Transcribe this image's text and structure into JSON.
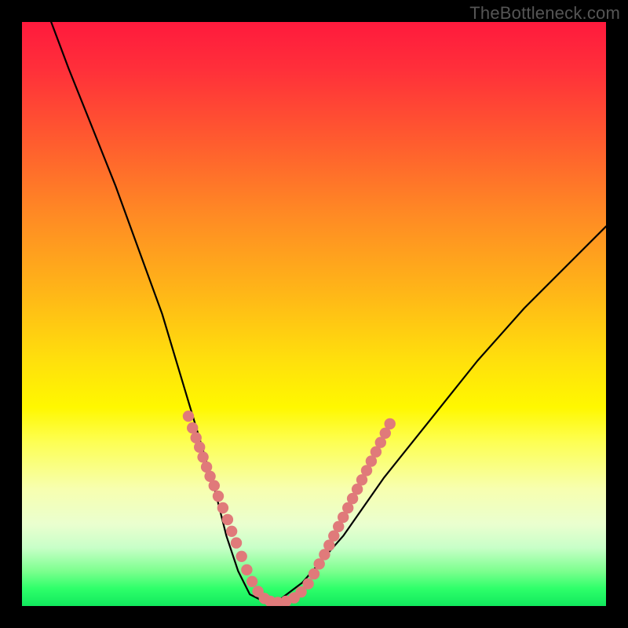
{
  "watermark": "TheBottleneck.com",
  "chart_data": {
    "type": "line",
    "title": "",
    "xlabel": "",
    "ylabel": "",
    "xlim": [
      0,
      100
    ],
    "ylim": [
      0,
      100
    ],
    "series": [
      {
        "name": "bottleneck-curve",
        "x": [
          5,
          8,
          12,
          16,
          20,
          24,
          27,
          30,
          33,
          35,
          37,
          39,
          41,
          44,
          48,
          55,
          62,
          70,
          78,
          86,
          95,
          100
        ],
        "y": [
          100,
          92,
          82,
          72,
          61,
          50,
          40,
          30,
          20,
          12,
          6,
          2,
          1,
          1,
          4,
          12,
          22,
          32,
          42,
          51,
          60,
          65
        ]
      }
    ],
    "dot_groups": [
      {
        "name": "left-dots",
        "color": "#e07a7a",
        "points": [
          [
            28.5,
            67.5
          ],
          [
            29.2,
            69.5
          ],
          [
            29.8,
            71.2
          ],
          [
            30.4,
            72.8
          ],
          [
            31.0,
            74.5
          ],
          [
            31.6,
            76.2
          ],
          [
            32.2,
            77.8
          ],
          [
            32.9,
            79.4
          ],
          [
            33.6,
            81.2
          ],
          [
            34.4,
            83.2
          ],
          [
            35.2,
            85.2
          ],
          [
            35.9,
            87.2
          ],
          [
            36.7,
            89.2
          ],
          [
            37.6,
            91.5
          ],
          [
            38.5,
            93.8
          ],
          [
            39.4,
            95.8
          ],
          [
            40.4,
            97.5
          ],
          [
            41.5,
            98.7
          ]
        ]
      },
      {
        "name": "bottom-dots",
        "color": "#e07a7a",
        "points": [
          [
            42.5,
            99.2
          ],
          [
            43.8,
            99.4
          ],
          [
            45.2,
            99.2
          ],
          [
            46.6,
            98.6
          ],
          [
            47.8,
            97.6
          ],
          [
            49.0,
            96.2
          ]
        ]
      },
      {
        "name": "right-dots",
        "color": "#e07a7a",
        "points": [
          [
            50.0,
            94.5
          ],
          [
            50.9,
            92.8
          ],
          [
            51.8,
            91.2
          ],
          [
            52.6,
            89.6
          ],
          [
            53.4,
            88.0
          ],
          [
            54.2,
            86.4
          ],
          [
            55.0,
            84.8
          ],
          [
            55.8,
            83.2
          ],
          [
            56.6,
            81.6
          ],
          [
            57.4,
            80.0
          ],
          [
            58.2,
            78.4
          ],
          [
            59.0,
            76.8
          ],
          [
            59.8,
            75.2
          ],
          [
            60.6,
            73.6
          ],
          [
            61.4,
            72.0
          ],
          [
            62.2,
            70.4
          ],
          [
            63.0,
            68.8
          ]
        ]
      }
    ],
    "colors": {
      "curve_stroke": "#000000",
      "dot_fill": "#e07a7a",
      "background_black": "#000000"
    }
  }
}
